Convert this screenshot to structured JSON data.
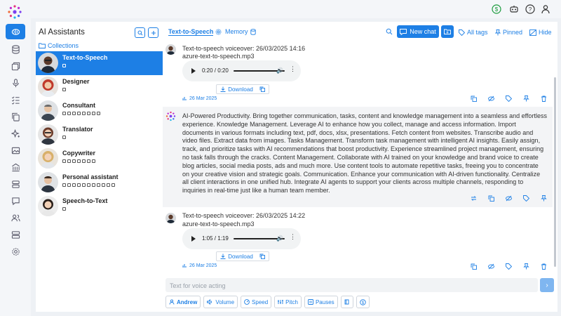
{
  "colors": {
    "accent": "#1d7fe5",
    "panel": "#ffffff",
    "background": "#eef1f5"
  },
  "rail": {
    "icons": [
      "brain-icon",
      "database-icon",
      "gallery-icon",
      "microphone-icon",
      "checklist-icon",
      "copy-icon",
      "sparkles-icon",
      "image-icon",
      "bank-icon",
      "layers-icon",
      "chat-icon",
      "users-icon",
      "server-icon",
      "settings-icon"
    ]
  },
  "topbar": {
    "icons": [
      "dollar-icon",
      "robot-icon",
      "help-icon",
      "user-icon"
    ]
  },
  "assistants": {
    "title": "AI Assistants",
    "collections_label": "Collections",
    "items": [
      {
        "name": "Text-to-Speech",
        "active": true
      },
      {
        "name": "Designer",
        "active": false
      },
      {
        "name": "Consultant",
        "active": false
      },
      {
        "name": "Translator",
        "active": false
      },
      {
        "name": "Copywriter",
        "active": false
      },
      {
        "name": "Personal assistant",
        "active": false
      },
      {
        "name": "Speech-to-Text",
        "active": false
      }
    ]
  },
  "chat": {
    "tab_active": "Text-to-Speech",
    "tab_memory": "Memory",
    "new_chat": "New chat",
    "all_tags": "All tags",
    "pinned": "Pinned",
    "hide": "Hide",
    "messages": [
      {
        "title": "Text-to-speech voiceover: 26/03/2025 14:16",
        "file": "azure-text-to-speech.mp3",
        "time": "0:20 / 0:20",
        "download": "Download",
        "date": "26 Mar 2025"
      },
      {
        "text": "AI-Powered Productivity. Bring together communication, tasks, content and knowledge management into a seamless and effortless experience. Knowledge Management. Leverage AI to enhance how you collect, manage and access information. Import documents in various formats including text, pdf, docs, xlsx, presentations. Fetch content from websites. Transcribe audio and video files. Extract data from images. Tasks Management. Transform task management with intelligent AI insights. Easily assign, track, and prioritize tasks with AI recommendations that boost productivity. Experience streamlined project management, ensuring no task falls through the cracks. Content Management. Collaborate with AI trained on your knowledge and brand voice to create blog articles, social media posts, ads and much more. Use content tools to automate repetitive tasks, freeing you to concentrate on your creative vision and strategic goals. Communication. Enhance your communication with AI-driven functionality. Centralize all client interactions in one unified hub. Integrate AI agents to support your clients across multiple channels, responding to inquiries in real-time just like a human team member."
      },
      {
        "title": "Text-to-speech voiceover: 26/03/2025 14:22",
        "file": "azure-text-to-speech.mp3",
        "time": "1:05 / 1:19",
        "download": "Download",
        "date": "26 Mar 2025"
      }
    ],
    "input_placeholder": "Text for voice acting",
    "tools": {
      "voice": "Andrew",
      "volume": "Volume",
      "speed": "Speed",
      "pitch": "Pitch",
      "pauses": "Pauses"
    }
  }
}
